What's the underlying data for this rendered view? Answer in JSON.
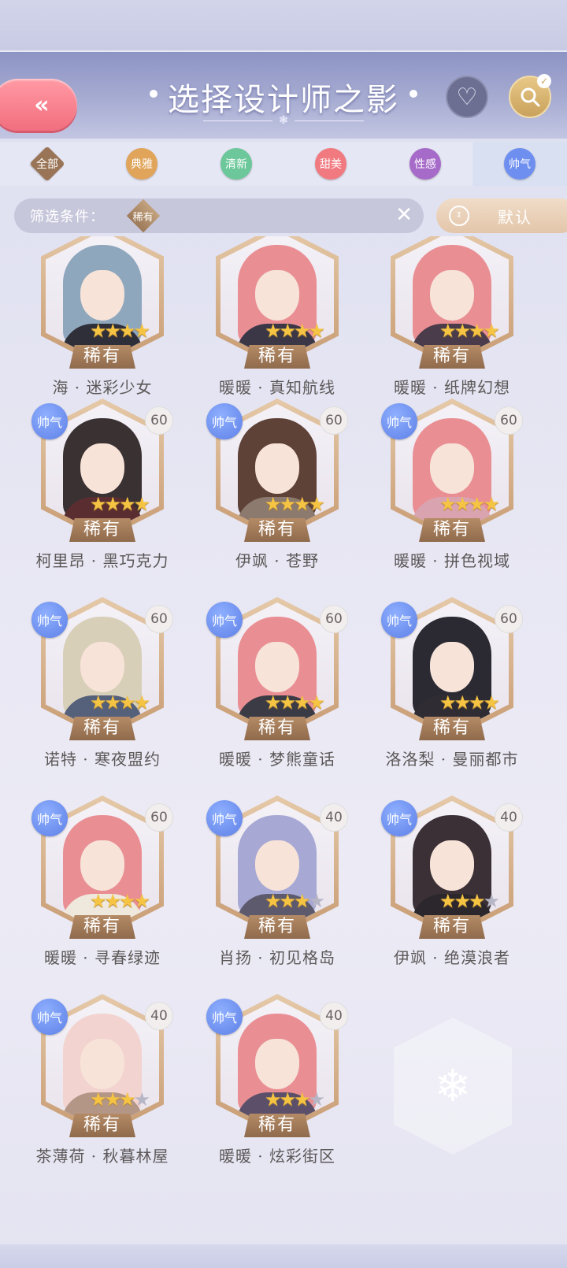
{
  "header": {
    "back_icon": "double-chevron-left-icon",
    "back_glyph": "«",
    "title": "选择设计师之影",
    "heart_icon": "heart-icon",
    "search_icon": "search-icon"
  },
  "tabs": [
    {
      "label": "全部",
      "color": "#9a7456",
      "shape": "diamond",
      "active": false
    },
    {
      "label": "典雅",
      "color": "#e0a45a",
      "shape": "circle",
      "active": false
    },
    {
      "label": "清新",
      "color": "#6cc79a",
      "shape": "circle",
      "active": false
    },
    {
      "label": "甜美",
      "color": "#f17a80",
      "shape": "circle",
      "active": false
    },
    {
      "label": "性感",
      "color": "#a66ac9",
      "shape": "circle",
      "active": false
    },
    {
      "label": "帅气",
      "color": "#6f8ff0",
      "shape": "circle",
      "active": true
    }
  ],
  "filter": {
    "label": "筛选条件：",
    "tag": "稀有",
    "clear_icon": "close-icon"
  },
  "sort": {
    "label": "默认",
    "icon": "sort-arrows-icon"
  },
  "cards": [
    {
      "name": "海 · 迷彩少女",
      "stars": 4,
      "max_stars": 4,
      "badge": "",
      "level": "",
      "hair": "#8fa7bd",
      "body": "#2f2f3a",
      "rarity": "稀有"
    },
    {
      "name": "暖暖 · 真知航线",
      "stars": 4,
      "max_stars": 4,
      "badge": "",
      "level": "",
      "hair": "#e98f94",
      "body": "#3b3747",
      "rarity": "稀有"
    },
    {
      "name": "暖暖 · 纸牌幻想",
      "stars": 4,
      "max_stars": 4,
      "badge": "",
      "level": "",
      "hair": "#e98f94",
      "body": "#4a3c4a",
      "rarity": "稀有"
    },
    {
      "name": "柯里昂 · 黑巧克力",
      "stars": 4,
      "max_stars": 4,
      "badge": "帅气",
      "level": "60",
      "hair": "#3a3133",
      "body": "#5a2e30",
      "rarity": "稀有"
    },
    {
      "name": "伊飒 · 苍野",
      "stars": 4,
      "max_stars": 4,
      "badge": "帅气",
      "level": "60",
      "hair": "#5e4137",
      "body": "#8c7a6e",
      "rarity": "稀有"
    },
    {
      "name": "暖暖 · 拼色视域",
      "stars": 4,
      "max_stars": 4,
      "badge": "帅气",
      "level": "60",
      "hair": "#e98f94",
      "body": "#d9a3b0",
      "rarity": "稀有"
    },
    {
      "name": "诺特 · 寒夜盟约",
      "stars": 4,
      "max_stars": 4,
      "badge": "帅气",
      "level": "60",
      "hair": "#d8cfb8",
      "body": "#55607a",
      "rarity": "稀有"
    },
    {
      "name": "暖暖 · 梦熊童话",
      "stars": 4,
      "max_stars": 4,
      "badge": "帅气",
      "level": "60",
      "hair": "#e98f94",
      "body": "#3b3b46",
      "rarity": "稀有"
    },
    {
      "name": "洛洛梨 · 曼丽都市",
      "stars": 4,
      "max_stars": 4,
      "badge": "帅气",
      "level": "60",
      "hair": "#2b2a33",
      "body": "#2f2d33",
      "rarity": "稀有"
    },
    {
      "name": "暖暖 · 寻春绿迹",
      "stars": 4,
      "max_stars": 4,
      "badge": "帅气",
      "level": "60",
      "hair": "#e98f94",
      "body": "#efe8dc",
      "rarity": "稀有"
    },
    {
      "name": "肖扬 · 初见格岛",
      "stars": 3,
      "max_stars": 4,
      "badge": "帅气",
      "level": "40",
      "hair": "#a7a9d4",
      "body": "#5d5a6e",
      "rarity": "稀有"
    },
    {
      "name": "伊飒 · 绝漠浪者",
      "stars": 3,
      "max_stars": 4,
      "badge": "帅气",
      "level": "40",
      "hair": "#3a3036",
      "body": "#2c272c",
      "rarity": "稀有"
    },
    {
      "name": "茶薄荷 · 秋暮林屋",
      "stars": 3,
      "max_stars": 4,
      "badge": "帅气",
      "level": "40",
      "hair": "#f2d3cf",
      "body": "#b49686",
      "rarity": "稀有"
    },
    {
      "name": "暖暖 · 炫彩街区",
      "stars": 3,
      "max_stars": 4,
      "badge": "帅气",
      "level": "40",
      "hair": "#e98f94",
      "body": "#5b4f6a",
      "rarity": "稀有"
    }
  ],
  "empty_slot_icon": "snowflake-icon",
  "empty_slot_glyph": "❄"
}
